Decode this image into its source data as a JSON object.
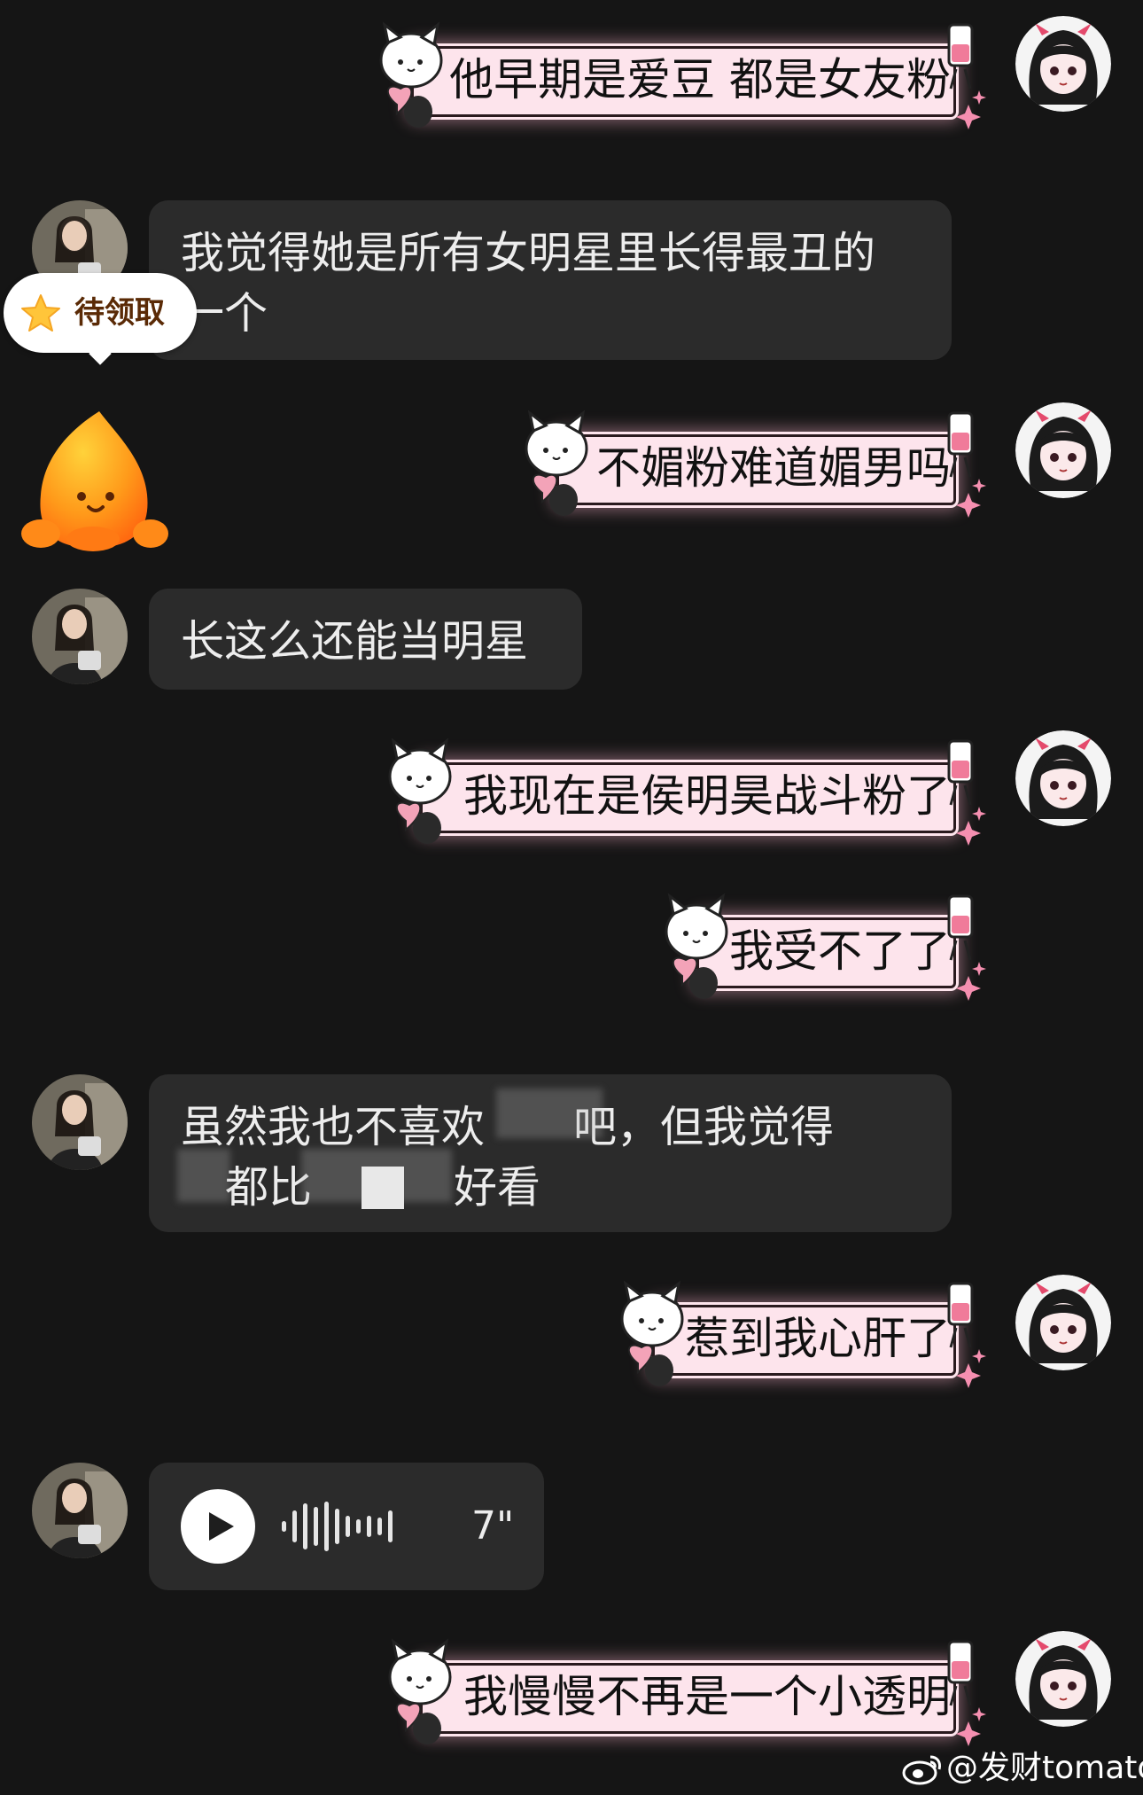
{
  "messages": {
    "m1": {
      "text": "他早期是爱豆 都是女友粉"
    },
    "m2": {
      "text_line1": "我觉得她是所有女明星里长得最丑的",
      "text_line2": "一个"
    },
    "m3": {
      "text": "不媚粉难道媚男吗"
    },
    "m4": {
      "text": "长这么还能当明星"
    },
    "m5": {
      "text": "我现在是侯明昊战斗粉了"
    },
    "m6": {
      "text": "我受不了了"
    },
    "m7": {
      "text_line1_a": "虽然我也不喜欢",
      "text_line1_b": "吧，但我觉得",
      "text_line2_a": "都比",
      "text_line2_b": "好看"
    },
    "m8": {
      "text": "惹到我心肝了"
    },
    "m9": {
      "duration": "7\""
    },
    "m10": {
      "text": "我慢慢不再是一个小透明"
    }
  },
  "reward_badge": {
    "label": "待领取",
    "icon": "star-icon"
  },
  "mascot": {
    "icon": "orange-mascot-icon"
  },
  "watermark": {
    "text": "@发财tomato",
    "icon": "weibo-icon"
  },
  "colors": {
    "background": "#151515",
    "received_bubble": "#2b2b2b",
    "sent_bubble": "#fde4ec",
    "received_text": "#ededed",
    "sent_text": "#111111",
    "badge_text": "#5a2a06"
  }
}
